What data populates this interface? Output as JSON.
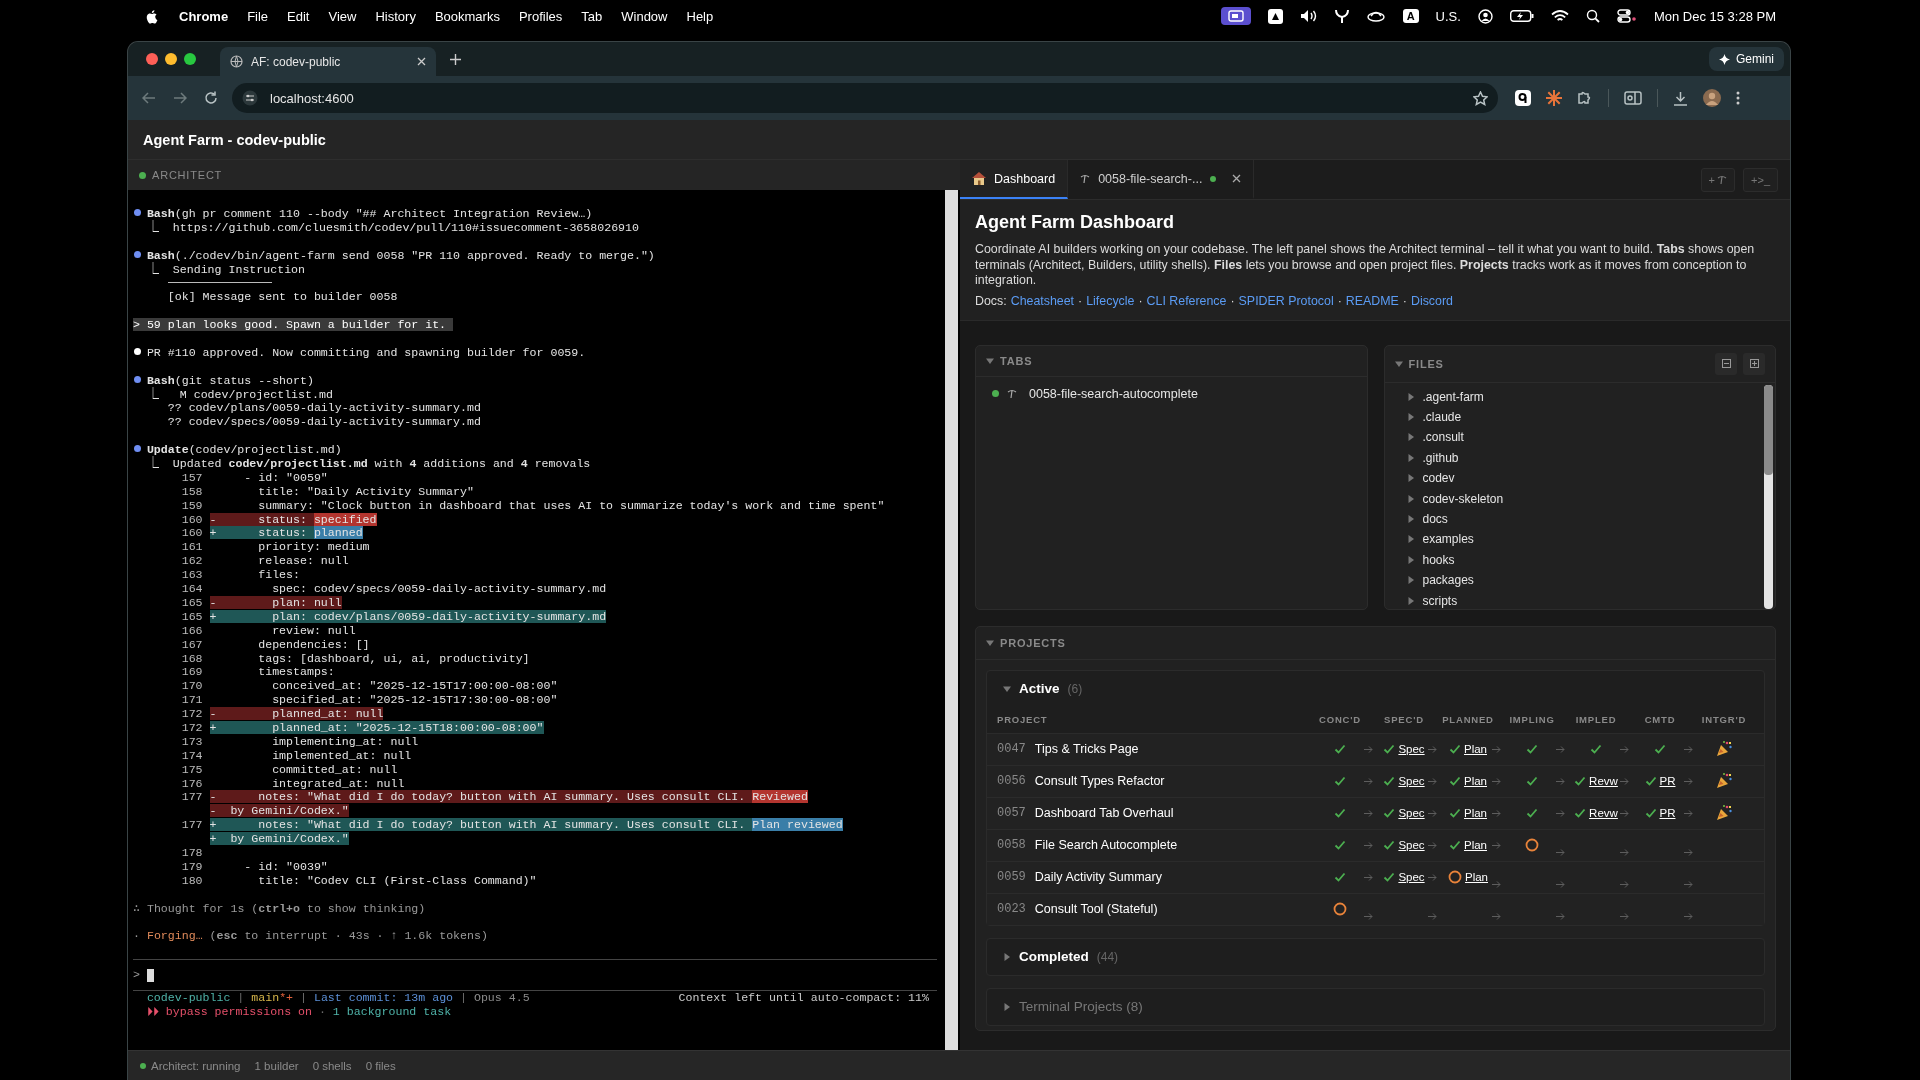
{
  "menubar": {
    "app": "Chrome",
    "menus": [
      "File",
      "Edit",
      "View",
      "History",
      "Bookmarks",
      "Profiles",
      "Tab",
      "Window",
      "Help"
    ],
    "input_badge": "A",
    "input_source": "U.S.",
    "clock": "Mon Dec 15  3:28 PM"
  },
  "browser": {
    "tabs": [
      {
        "title": "AF: codev-public",
        "selected": true
      }
    ],
    "address": "localhost:4600",
    "gemini": "Gemini"
  },
  "app": {
    "title": "Agent Farm - codev-public"
  },
  "architect": {
    "label": "ARCHITECT",
    "lines": [
      {
        "kind": "tool",
        "text": "**Bash**(gh pr comment 110 --body \"## Architect Integration Review…)"
      },
      {
        "kind": "result",
        "text": "⎿  https://github.com/cluesmith/codev/pull/110#issuecomment-3658026910"
      },
      {
        "kind": "blank"
      },
      {
        "kind": "tool",
        "text": "**Bash**(./codev/bin/agent-farm send 0058 \"PR 110 approved. Ready to merge.\")"
      },
      {
        "kind": "result",
        "text": "⎿  Sending Instruction"
      },
      {
        "kind": "rule"
      },
      {
        "kind": "plain",
        "text": "[ok] Message sent to builder 0058"
      },
      {
        "kind": "blank"
      },
      {
        "kind": "prompt",
        "text": "> 59 plan looks good. Spawn a builder for it. "
      },
      {
        "kind": "blank"
      },
      {
        "kind": "message",
        "text": "PR #110 approved. Now committing and spawning builder for 0059."
      },
      {
        "kind": "blank"
      },
      {
        "kind": "tool",
        "text": "**Bash**(git status --short)"
      },
      {
        "kind": "result",
        "text": "⎿   M codev/projectlist.md"
      },
      {
        "kind": "plain",
        "text": "?? codev/plans/0059-daily-activity-summary.md"
      },
      {
        "kind": "plain",
        "text": "?? codev/specs/0059-daily-activity-summary.md"
      },
      {
        "kind": "blank"
      },
      {
        "kind": "tool",
        "text": "**Update**(codev/projectlist.md)"
      },
      {
        "kind": "result",
        "text": "⎿  Updated **codev/projectlist.md** with **4** additions and **4** removals"
      },
      {
        "kind": "context",
        "num": "157",
        "code": "    - id: \"0059\""
      },
      {
        "kind": "context",
        "num": "158",
        "code": "      title: \"Daily Activity Summary\""
      },
      {
        "kind": "context",
        "num": "159",
        "code": "      summary: \"Clock button in dashboard that uses AI to summarize today's work and time spent\""
      },
      {
        "kind": "del",
        "num": "160",
        "sign": "-",
        "code": "      status: ",
        "hl": "specified"
      },
      {
        "kind": "add",
        "num": "160",
        "sign": "+",
        "code": "      status: ",
        "hl": "planned"
      },
      {
        "kind": "context",
        "num": "161",
        "code": "      priority: medium"
      },
      {
        "kind": "context",
        "num": "162",
        "code": "      release: null"
      },
      {
        "kind": "context",
        "num": "163",
        "code": "      files:"
      },
      {
        "kind": "context",
        "num": "164",
        "code": "        spec: codev/specs/0059-daily-activity-summary.md"
      },
      {
        "kind": "del",
        "num": "165",
        "sign": "-",
        "code": "        plan: null"
      },
      {
        "kind": "add",
        "num": "165",
        "sign": "+",
        "code": "        plan: codev/plans/0059-daily-activity-summary.md"
      },
      {
        "kind": "context",
        "num": "166",
        "code": "        review: null"
      },
      {
        "kind": "context",
        "num": "167",
        "code": "      dependencies: []"
      },
      {
        "kind": "context",
        "num": "168",
        "code": "      tags: [dashboard, ui, ai, productivity]"
      },
      {
        "kind": "context",
        "num": "169",
        "code": "      timestamps:"
      },
      {
        "kind": "context",
        "num": "170",
        "code": "        conceived_at: \"2025-12-15T17:00:00-08:00\""
      },
      {
        "kind": "context",
        "num": "171",
        "code": "        specified_at: \"2025-12-15T17:30:00-08:00\""
      },
      {
        "kind": "del",
        "num": "172",
        "sign": "-",
        "code": "        planned_at: null"
      },
      {
        "kind": "add",
        "num": "172",
        "sign": "+",
        "code": "        planned_at: \"2025-12-15T18:00:00-08:00\""
      },
      {
        "kind": "context",
        "num": "173",
        "code": "        implementing_at: null"
      },
      {
        "kind": "context",
        "num": "174",
        "code": "        implemented_at: null"
      },
      {
        "kind": "context",
        "num": "175",
        "code": "        committed_at: null"
      },
      {
        "kind": "context",
        "num": "176",
        "code": "        integrated_at: null"
      },
      {
        "kind": "del",
        "num": "177",
        "sign": "-",
        "code": "      notes: \"What did I do today? button with AI summary. Uses consult CLI. ",
        "hl": "Reviewed"
      },
      {
        "kind": "del",
        "sign": "-",
        "code": "  by Gemini/Codex.\""
      },
      {
        "kind": "add",
        "num": "177",
        "sign": "+",
        "code": "      notes: \"What did I do today? button with AI summary. Uses consult CLI. ",
        "hl": "Plan reviewed"
      },
      {
        "kind": "add",
        "sign": "+",
        "code": "  by Gemini/Codex.\""
      },
      {
        "kind": "context",
        "num": "178"
      },
      {
        "kind": "context",
        "num": "179",
        "code": "    - id: \"0039\""
      },
      {
        "kind": "context",
        "num": "180",
        "code": "      title: \"Codev CLI (First-Class Command)\""
      },
      {
        "kind": "blank"
      },
      {
        "kind": "thought",
        "text": "∴ Thought for 1s (**ctrl+o** to show thinking)"
      },
      {
        "kind": "blank"
      },
      {
        "kind": "activity",
        "marker": "·",
        "verb": "Forging…",
        "text": "(**esc** to interrupt · 43s · ↑ 1.6k tokens)"
      }
    ],
    "input_prompt": ">",
    "statusline": [
      {
        "segments": [
          {
            "text": "codev-public",
            "kind": "project"
          },
          {
            "text": " | ",
            "kind": "separator"
          },
          {
            "text": "main",
            "kind": "branch"
          },
          {
            "text": "*+",
            "kind": "dirty"
          },
          {
            "text": " | ",
            "kind": "separator"
          },
          {
            "text": "Last commit: 13m ago",
            "kind": "commit"
          },
          {
            "text": " | ",
            "kind": "separator"
          },
          {
            "text": "Opus 4.5",
            "kind": "model"
          }
        ],
        "right": "Context left until auto-compact: 11%"
      },
      {
        "segments": [
          {
            "text": "⏵⏵ bypass permissions on",
            "kind": "mode"
          },
          {
            "text": " · ",
            "kind": "separator"
          },
          {
            "text": "1 background task",
            "kind": "project"
          }
        ]
      }
    ]
  },
  "dashboard": {
    "tabs": [
      {
        "label": "Dashboard",
        "kind": "dashboard",
        "selected": true
      },
      {
        "label": "0058-file-search-...",
        "kind": "builder",
        "running": true,
        "closable": true,
        "selected": false
      }
    ],
    "tab_actions": [
      {
        "kind": "builder",
        "label": "+"
      },
      {
        "kind": "shell",
        "label": "+>_"
      }
    ],
    "title": "Agent Farm Dashboard",
    "description": "Coordinate AI builders working on your codebase. The left panel shows the Architect terminal – tell it what you want to build. **Tabs** shows open terminals (Architect, Builders, utility shells). **Files** lets you browse and open project files. **Projects** tracks work as it moves from conception to integration.",
    "docs": {
      "label": "Docs:",
      "separator": "·",
      "links": [
        "Cheatsheet",
        "Lifecycle",
        "CLI Reference",
        "SPIDER Protocol",
        "README",
        "Discord"
      ]
    },
    "tabs_panel": {
      "title": "TABS",
      "expanded": true,
      "items": [
        {
          "label": "0058-file-search-autocomplete",
          "running": true
        }
      ]
    },
    "files_panel": {
      "title": "FILES",
      "expanded": true,
      "items": [
        {
          "name": ".agent-farm",
          "expanded": false
        },
        {
          "name": ".claude",
          "expanded": false
        },
        {
          "name": ".consult",
          "expanded": false
        },
        {
          "name": ".github",
          "expanded": false
        },
        {
          "name": "codev",
          "expanded": false
        },
        {
          "name": "codev-skeleton",
          "expanded": false
        },
        {
          "name": "docs",
          "expanded": false
        },
        {
          "name": "examples",
          "expanded": false
        },
        {
          "name": "hooks",
          "expanded": false
        },
        {
          "name": "packages",
          "expanded": false
        },
        {
          "name": "scripts",
          "expanded": false
        }
      ]
    },
    "projects": {
      "title": "PROJECTS",
      "expanded": true,
      "groups": [
        {
          "label": "Active",
          "count": "(6)",
          "expanded": true,
          "muted": false,
          "columns": [
            "PROJECT",
            "CONC'D",
            "SPEC'D",
            "PLANNED",
            "IMPLING",
            "IMPLED",
            "CMTD",
            "INTGR'D"
          ],
          "rows": [
            {
              "id": "0047",
              "title": "Tips & Tricks Page",
              "stages": [
                {
                  "kind": "done"
                },
                {
                  "kind": "done",
                  "link": "Spec"
                },
                {
                  "kind": "done",
                  "link": "Plan"
                },
                {
                  "kind": "done"
                },
                {
                  "kind": "done"
                },
                {
                  "kind": "done"
                },
                {
                  "kind": "integrated"
                }
              ]
            },
            {
              "id": "0056",
              "title": "Consult Types Refactor",
              "stages": [
                {
                  "kind": "done"
                },
                {
                  "kind": "done",
                  "link": "Spec"
                },
                {
                  "kind": "done",
                  "link": "Plan"
                },
                {
                  "kind": "done"
                },
                {
                  "kind": "done",
                  "link": "Revw"
                },
                {
                  "kind": "done",
                  "link": "PR"
                },
                {
                  "kind": "integrated"
                }
              ]
            },
            {
              "id": "0057",
              "title": "Dashboard Tab Overhaul",
              "stages": [
                {
                  "kind": "done"
                },
                {
                  "kind": "done",
                  "link": "Spec"
                },
                {
                  "kind": "done",
                  "link": "Plan"
                },
                {
                  "kind": "done"
                },
                {
                  "kind": "done",
                  "link": "Revw"
                },
                {
                  "kind": "done",
                  "link": "PR"
                },
                {
                  "kind": "integrated"
                }
              ]
            },
            {
              "id": "0058",
              "title": "File Search Autocomplete",
              "stages": [
                {
                  "kind": "done"
                },
                {
                  "kind": "done",
                  "link": "Spec"
                },
                {
                  "kind": "done",
                  "link": "Plan"
                },
                {
                  "kind": "current"
                },
                {
                  "kind": "pending"
                },
                {
                  "kind": "pending"
                },
                {
                  "kind": "pending"
                }
              ]
            },
            {
              "id": "0059",
              "title": "Daily Activity Summary",
              "stages": [
                {
                  "kind": "done"
                },
                {
                  "kind": "done",
                  "link": "Spec"
                },
                {
                  "kind": "current",
                  "link": "Plan"
                },
                {
                  "kind": "pending"
                },
                {
                  "kind": "pending"
                },
                {
                  "kind": "pending"
                },
                {
                  "kind": "pending"
                }
              ]
            },
            {
              "id": "0023",
              "title": "Consult Tool (Stateful)",
              "stages": [
                {
                  "kind": "current"
                },
                {
                  "kind": "pending"
                },
                {
                  "kind": "pending"
                },
                {
                  "kind": "pending"
                },
                {
                  "kind": "pending"
                },
                {
                  "kind": "pending"
                },
                {
                  "kind": "pending"
                }
              ]
            }
          ]
        },
        {
          "label": "Completed",
          "count": "(44)",
          "expanded": false,
          "muted": false
        },
        {
          "label": "Terminal Projects (8)",
          "expanded": false,
          "muted": true
        }
      ]
    }
  },
  "status_bar": {
    "items": [
      "Architect: running",
      "1 builder",
      "0 shells",
      "0 files"
    ]
  }
}
